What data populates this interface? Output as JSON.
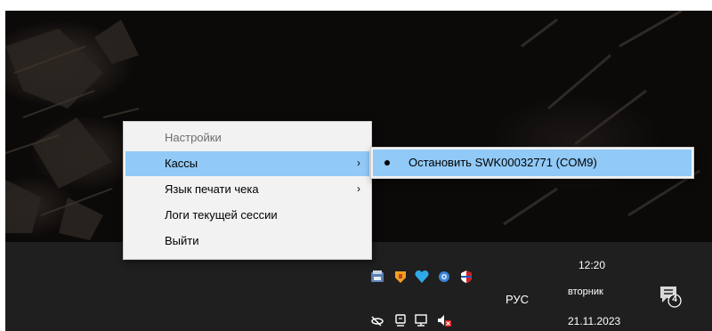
{
  "main_menu": {
    "items": [
      {
        "label": "Настройки",
        "enabled": false,
        "has_submenu": false
      },
      {
        "label": "Кассы",
        "enabled": true,
        "has_submenu": true,
        "highlighted": true
      },
      {
        "label": "Язык печати чека",
        "enabled": true,
        "has_submenu": true
      },
      {
        "label": "Логи текущей сессии",
        "enabled": true,
        "has_submenu": false
      },
      {
        "label": "Выйти",
        "enabled": true,
        "has_submenu": false
      }
    ],
    "submenu_arrow": "›"
  },
  "submenu": {
    "items": [
      {
        "label": "Остановить SWK00032771 (COM9)",
        "checked": true,
        "highlighted": true
      }
    ]
  },
  "taskbar": {
    "language": "РУС",
    "clock": {
      "time": "12:20",
      "weekday": "вторник",
      "date": "21.11.2023"
    },
    "notification_count": "4",
    "tray_icons_top": [
      "printer-app-icon",
      "shield-app-icon",
      "vpn-heart-icon",
      "gear-icon",
      "security-shield-icon"
    ],
    "tray_icons_bottom": [
      "location-icon",
      "pen-device-icon",
      "network-icon",
      "volume-muted-icon"
    ]
  },
  "colors": {
    "menu_background": "#f2f2f2",
    "menu_highlight": "#91c9f7",
    "taskbar_background": "#1f1f1f",
    "disabled_text": "#6d6d6d"
  }
}
